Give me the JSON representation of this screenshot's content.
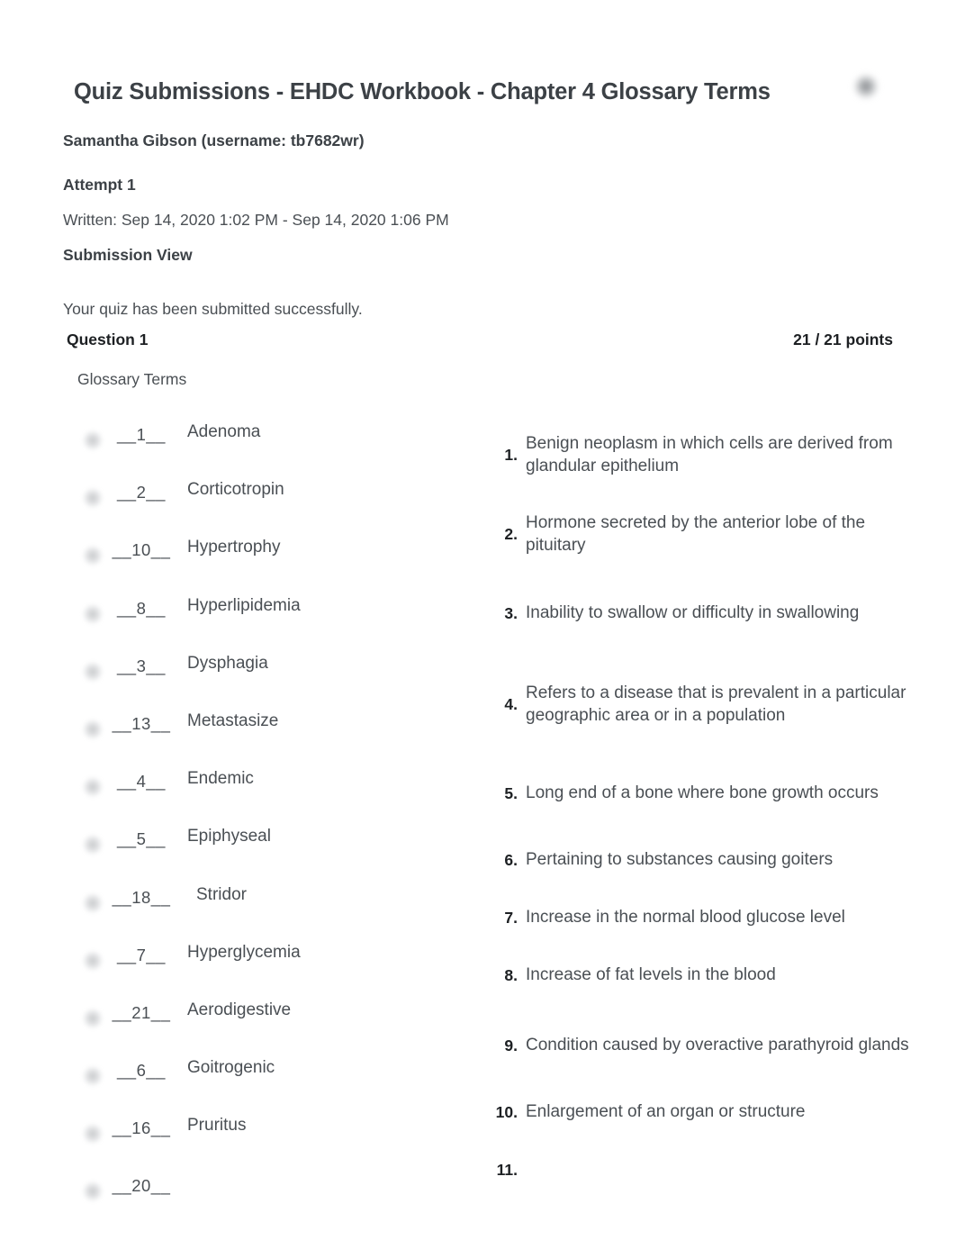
{
  "header": {
    "title": "Quiz Submissions - EHDC Workbook - Chapter 4 Glossary Terms",
    "corner_icon": "blurred-redacted-icon"
  },
  "meta": {
    "user": "Samantha Gibson (username: tb7682wr)",
    "attempt": "Attempt 1",
    "written": "Written: Sep 14, 2020 1:02 PM - Sep 14, 2020 1:06 PM",
    "submission_view": "Submission View",
    "success_message": "Your quiz has been submitted successfully."
  },
  "question": {
    "label": "Question 1",
    "points": "21 / 21 points",
    "prompt": "Glossary Terms"
  },
  "matching": {
    "terms": [
      {
        "answer": "__1__",
        "term": "Adenoma",
        "icon": "answer-marker-icon"
      },
      {
        "answer": "__2__",
        "term": "Corticotropin",
        "icon": "answer-marker-icon"
      },
      {
        "answer": "__10__",
        "term": "Hypertrophy",
        "icon": "answer-marker-icon"
      },
      {
        "answer": "__8__",
        "term": "Hyperlipidemia",
        "icon": "answer-marker-icon"
      },
      {
        "answer": "__3__",
        "term": "Dysphagia",
        "icon": "answer-marker-icon"
      },
      {
        "answer": "__13__",
        "term": "Metastasize",
        "icon": "answer-marker-icon"
      },
      {
        "answer": "__4__",
        "term": "Endemic",
        "icon": "answer-marker-icon"
      },
      {
        "answer": "__5__",
        "term": "Epiphyseal",
        "icon": "answer-marker-icon"
      },
      {
        "answer": "__18__",
        "term": "Stridor",
        "icon": "answer-marker-icon"
      },
      {
        "answer": "__7__",
        "term": "Hyperglycemia",
        "icon": "answer-marker-icon"
      },
      {
        "answer": "__21__",
        "term": "Aerodigestive",
        "icon": "answer-marker-icon"
      },
      {
        "answer": "__6__",
        "term": "Goitrogenic",
        "icon": "answer-marker-icon"
      },
      {
        "answer": "__16__",
        "term": "Pruritus",
        "icon": "answer-marker-icon"
      },
      {
        "answer": "__20__",
        "term": "",
        "icon": "answer-marker-icon"
      }
    ],
    "definitions": [
      {
        "num": "1.",
        "text": "Benign neoplasm in which cells are derived from glandular epithelium"
      },
      {
        "num": "2.",
        "text": "Hormone secreted by the anterior lobe of the pituitary"
      },
      {
        "num": "3.",
        "text": "Inability to swallow or difficulty in swallowing"
      },
      {
        "num": "4.",
        "text": "Refers to a disease that is prevalent in a particular geographic area or in a population"
      },
      {
        "num": "5.",
        "text": "Long end of a bone where bone growth occurs"
      },
      {
        "num": "6.",
        "text": "Pertaining to substances causing goiters"
      },
      {
        "num": "7.",
        "text": "Increase in the normal blood glucose level"
      },
      {
        "num": "8.",
        "text": "Increase of fat levels in the blood"
      },
      {
        "num": "9.",
        "text": "Condition caused by overactive parathyroid glands"
      },
      {
        "num": "10.",
        "text": "Enlargement of an organ or structure"
      },
      {
        "num": "11.",
        "text": ""
      }
    ]
  },
  "colors": {
    "page_background": "#ffffff",
    "body_text": "#4a4f54",
    "heading_text": "#1d2023"
  }
}
